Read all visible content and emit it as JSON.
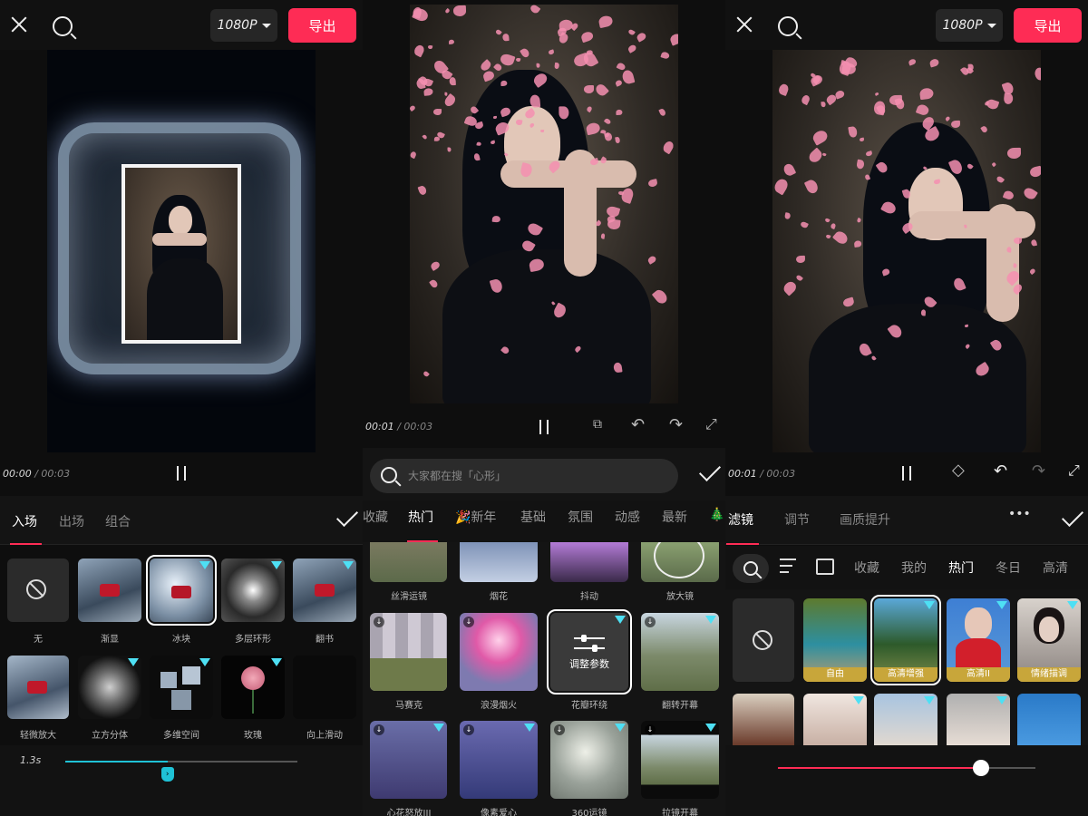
{
  "panel1": {
    "resolution": "1080P",
    "export": "导出",
    "time_current": "00:00",
    "time_total": " / 00:03",
    "tabs": [
      "入场",
      "出场",
      "组合"
    ],
    "effects": [
      "无",
      "渐显",
      "冰块",
      "多层环形",
      "翻书",
      "轻微放大",
      "立方分体",
      "多维空间",
      "玫瑰",
      "向上滑动"
    ],
    "duration": "1.3s",
    "duration_fraction": 0.44
  },
  "panel2": {
    "time_current": "00:01",
    "time_total": " / 00:03",
    "search_placeholder": "大家都在搜「心形」",
    "categories": [
      "收藏",
      "热门",
      "🎉新年",
      "基础",
      "氛围",
      "动感",
      "最新",
      "🎄"
    ],
    "effects_row1": [
      "丝滑运镜",
      "烟花",
      "抖动",
      "放大镜"
    ],
    "effects_row2": [
      "马赛克",
      "浪漫烟火",
      "花瓣环绕",
      "翻转开幕"
    ],
    "effects_row3": [
      "心花怒放III",
      "像素爱心",
      "360运镜",
      "拉镜开幕"
    ],
    "adjust_label": "调整参数"
  },
  "panel3": {
    "resolution": "1080P",
    "export": "导出",
    "time_current": "00:01",
    "time_total": " / 00:03",
    "tabs": [
      "滤镜",
      "调节",
      "画质提升"
    ],
    "more": "•••",
    "categories": [
      "收藏",
      "我的",
      "热门",
      "冬日",
      "高清"
    ],
    "filters": [
      "自由",
      "高清增强",
      "高清II",
      "情绪描调"
    ],
    "intensity_fraction": 0.79
  },
  "colors": {
    "accent": "#fe2c55",
    "cyan": "#1fc2d6",
    "gem": "#4ee0f4"
  }
}
